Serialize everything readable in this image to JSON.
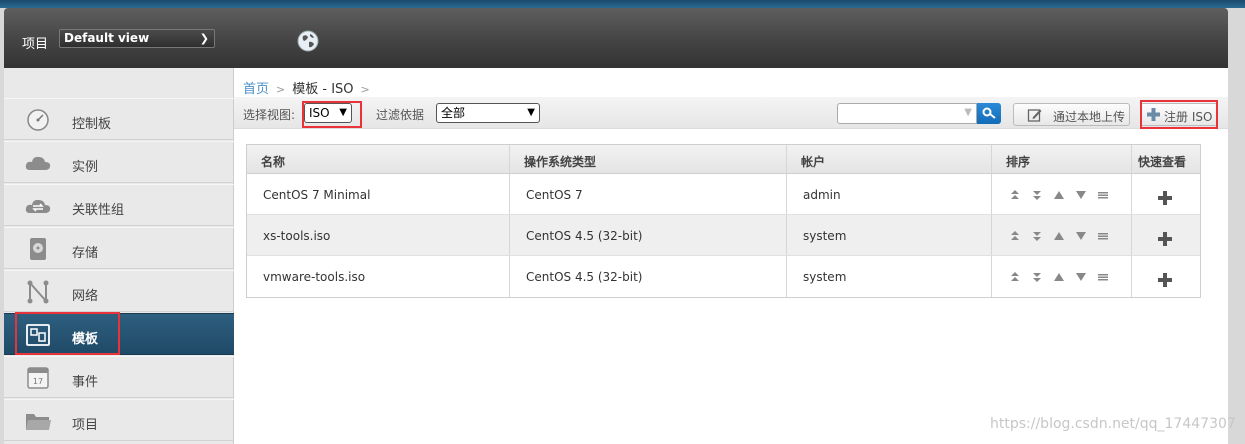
{
  "header": {
    "project_label": "项目",
    "view_select": "Default view"
  },
  "sidebar": {
    "items": [
      {
        "label": "控制板",
        "icon": "dashboard-icon"
      },
      {
        "label": "实例",
        "icon": "cloud-icon"
      },
      {
        "label": "关联性组",
        "icon": "affinity-cloud-icon"
      },
      {
        "label": "存储",
        "icon": "storage-disk-icon"
      },
      {
        "label": "网络",
        "icon": "network-icon"
      },
      {
        "label": "模板",
        "icon": "template-icon",
        "active": true
      },
      {
        "label": "事件",
        "icon": "calendar-icon"
      },
      {
        "label": "项目",
        "icon": "folder-icon"
      }
    ]
  },
  "breadcrumb": {
    "home": "首页",
    "current": "模板 - ISO"
  },
  "toolbar": {
    "select_view_label": "选择视图:",
    "select_view_value": "ISO",
    "filter_label": "过滤依据",
    "filter_value": "全部",
    "upload_local_label": "通过本地上传",
    "register_iso_label": "注册 ISO"
  },
  "table": {
    "headers": [
      "名称",
      "操作系统类型",
      "帐户",
      "排序",
      "快速查看"
    ],
    "rows": [
      {
        "name": "CentOS 7 Minimal",
        "os": "CentOS 7",
        "account": "admin"
      },
      {
        "name": "xs-tools.iso",
        "os": "CentOS 4.5 (32-bit)",
        "account": "system"
      },
      {
        "name": "vmware-tools.iso",
        "os": "CentOS 4.5 (32-bit)",
        "account": "system"
      }
    ]
  },
  "watermark": "https://blog.csdn.net/qq_17447307",
  "colors": {
    "accent_blue": "#4a8fc7",
    "active_nav": "#2e5f7f",
    "highlight_red": "#e8333a"
  }
}
